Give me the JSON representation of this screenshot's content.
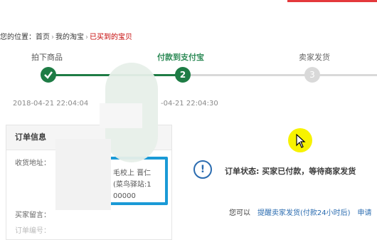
{
  "breadcrumb": {
    "prefix": "您的位置：",
    "home": "首页",
    "sep": "›",
    "mytaobao": "我的淘宝",
    "current": "已买到的宝贝"
  },
  "steps": [
    {
      "label": "拍下商品",
      "state": "done",
      "time": "2018-04-21 22:04:04"
    },
    {
      "label": "付款到支付宝",
      "state": "current",
      "number": "2",
      "time": "-04-21 22:04:30"
    },
    {
      "label": "卖家发货",
      "state": "pending",
      "number": "3"
    }
  ],
  "order_panel": {
    "title": "订单信息",
    "address_label": "收货地址：",
    "address_lines": [
      "毛校上 晋仁",
      "(菜鸟驿站:1",
      "00000"
    ],
    "message_label": "买家留言：",
    "order_no_label": "订单编号："
  },
  "status": {
    "icon": "!",
    "text": "订单状态: 买家已付款，等待商家发货",
    "prompt": "您可以",
    "remind_link": "提醒卖家发货(付款24小时后)",
    "more_link": "申请"
  },
  "colors": {
    "progress_green": "#1e7c45",
    "highlight_blue": "#1a9ad6",
    "cursor_highlight": "#f7f200",
    "link_blue": "#2b6cb0",
    "breadcrumb_red": "#c40000"
  }
}
